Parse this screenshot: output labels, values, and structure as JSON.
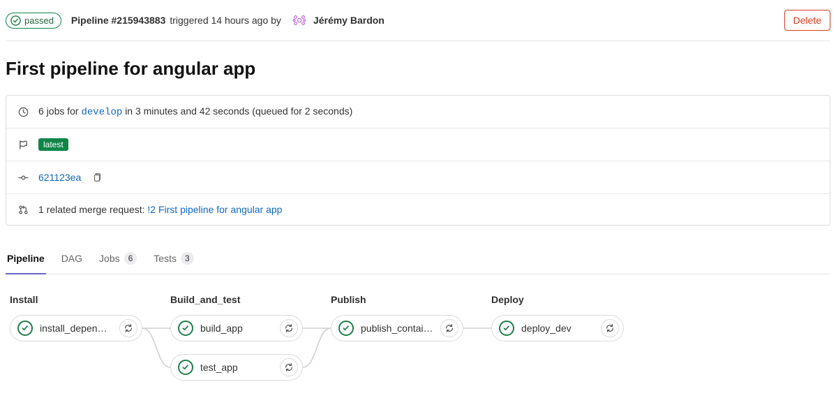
{
  "header": {
    "status_label": "passed",
    "pipeline_label": "Pipeline #215943883",
    "triggered_text": "triggered 14 hours ago by",
    "author": "Jérémy Bardon",
    "delete_label": "Delete"
  },
  "title": "First pipeline for angular app",
  "info": {
    "jobs_prefix": "6 jobs for",
    "branch": "develop",
    "jobs_suffix": "in 3 minutes and 42 seconds (queued for 2 seconds)",
    "latest_badge": "latest",
    "commit_sha": "621123ea",
    "mr_prefix": "1 related merge request:",
    "mr_link": "!2 First pipeline for angular app"
  },
  "tabs": {
    "pipeline": "Pipeline",
    "dag": "DAG",
    "jobs": "Jobs",
    "jobs_count": "6",
    "tests": "Tests",
    "tests_count": "3"
  },
  "stages": [
    {
      "name": "Install",
      "jobs": [
        "install_depend…"
      ]
    },
    {
      "name": "Build_and_test",
      "jobs": [
        "build_app",
        "test_app"
      ]
    },
    {
      "name": "Publish",
      "jobs": [
        "publish_contai…"
      ]
    },
    {
      "name": "Deploy",
      "jobs": [
        "deploy_dev"
      ]
    }
  ]
}
